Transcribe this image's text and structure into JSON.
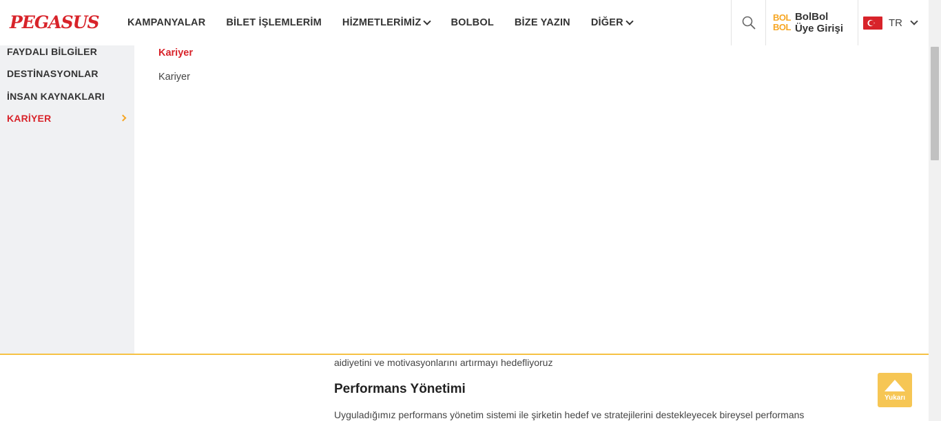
{
  "header": {
    "logo": "PEGASUS",
    "nav": [
      {
        "label": "KAMPANYALAR",
        "dropdown": false
      },
      {
        "label": "BİLET İŞLEMLERİM",
        "dropdown": false
      },
      {
        "label": "HİZMETLERİMİZ",
        "dropdown": true
      },
      {
        "label": "BOLBOL",
        "dropdown": false
      },
      {
        "label": "BİZE YAZIN",
        "dropdown": false
      },
      {
        "label": "DİĞER",
        "dropdown": true
      }
    ],
    "search_icon": "search-icon",
    "bolbol": {
      "logo_line1": "BOL",
      "logo_line2": "BOL",
      "line1": "BolBol",
      "line2": "Üye Girişi"
    },
    "language": {
      "flag": "turkey-flag-icon",
      "code": "TR"
    }
  },
  "mega_menu": {
    "side_items": [
      {
        "label": "FAYDALI BİLGİLER",
        "active": false
      },
      {
        "label": "DESTİNASYONLAR",
        "active": false
      },
      {
        "label": "İNSAN KAYNAKLARI",
        "active": false
      },
      {
        "label": "KARİYER",
        "active": true
      }
    ],
    "title": "Kariyer",
    "links": [
      "Kariyer"
    ]
  },
  "content": {
    "line": "aidiyetini ve motivasyonlarını artırmayı hedefliyoruz",
    "heading": "Performans Yönetimi",
    "paragraph": "Uyguladığımız performans yönetim sistemi ile şirketin hedef ve stratejilerini destekleyecek bireysel performans"
  },
  "back_to_top": {
    "label": "Yukarı"
  },
  "colors": {
    "brand_red": "#d8232a",
    "accent_yellow": "#f6c143",
    "side_bg": "#f0f1f3"
  }
}
